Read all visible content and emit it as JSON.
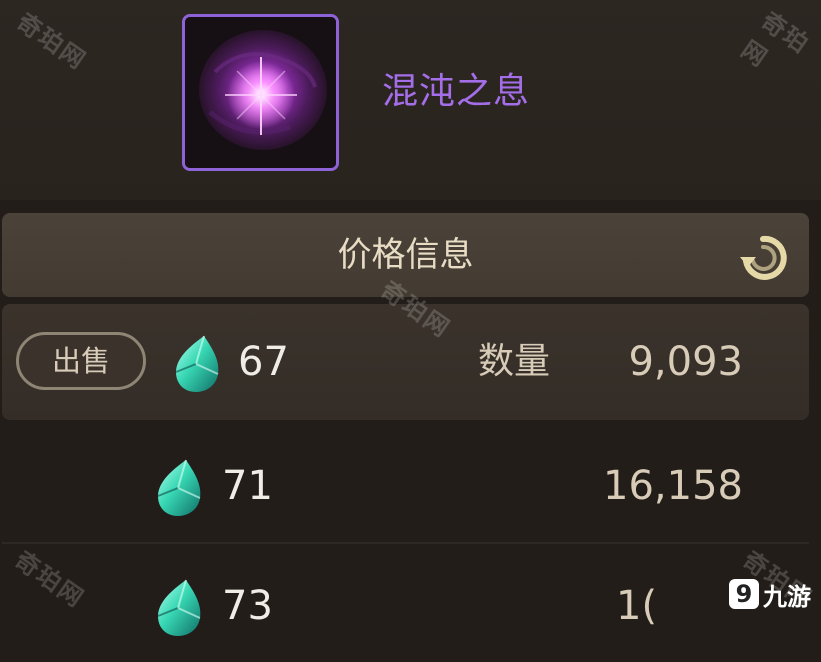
{
  "item": {
    "name": "混沌之息",
    "icon": "purple-orb-icon",
    "rarity_color": "#a46ee9"
  },
  "price_panel": {
    "title": "价格信息",
    "refresh_icon": "refresh-icon"
  },
  "listings": [
    {
      "sell_label": "出售",
      "price": "67",
      "quantity_label": "数量",
      "quantity": "9,093"
    },
    {
      "price": "71",
      "quantity": "16,158"
    },
    {
      "price": "73",
      "quantity": "1("
    }
  ],
  "currency_icon": "green-gem-icon",
  "watermark_text": "奇珀网",
  "brand": {
    "mark": "9",
    "name": "九游"
  }
}
